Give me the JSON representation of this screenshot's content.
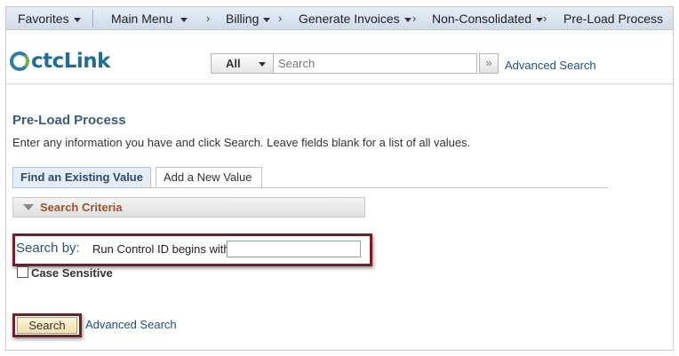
{
  "nav": {
    "favorites": "Favorites",
    "main_menu": "Main Menu",
    "breadcrumbs": [
      "Billing",
      "Generate Invoices",
      "Non-Consolidated",
      "Pre-Load Process"
    ]
  },
  "header": {
    "logo_text": "ctcLink",
    "search_scope": "All",
    "search_placeholder": "Search",
    "go_glyph": "»",
    "advanced_search": "Advanced Search"
  },
  "page": {
    "title": "Pre-Load Process",
    "instructions": "Enter any information you have and click Search. Leave fields blank for a list of all values.",
    "tabs": [
      "Find an Existing Value",
      "Add a New Value"
    ],
    "search_criteria": "Search Criteria",
    "search_by_label": "Search by:",
    "run_control_label": "Run Control ID begins with",
    "run_control_value": "",
    "case_sensitive": "Case Sensitive",
    "search_button": "Search",
    "advanced_search": "Advanced Search"
  },
  "colors": {
    "highlight": "#7a1b25",
    "link": "#1a4f8c",
    "criteria_text": "#a0522d",
    "brand": "#1d6f99"
  }
}
